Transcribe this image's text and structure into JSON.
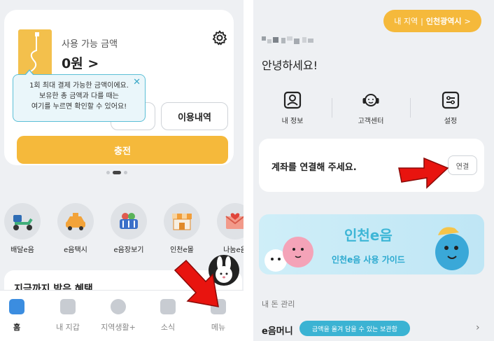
{
  "left": {
    "card": {
      "available_label": "사용 가능 금액",
      "available_amount": "0원 >",
      "history_button": "이용내역",
      "charge_button": "충전",
      "tooltip_lines": [
        "1회 최대 결제 가능한 금액이에요.",
        "보유한 총 금액과 다를 때는",
        "여기를 누르면 확인할 수 있어요!"
      ],
      "tooltip_close": "✕"
    },
    "services": [
      {
        "label": "배달e음",
        "icon": "scooter-icon"
      },
      {
        "label": "e음택시",
        "icon": "taxi-icon"
      },
      {
        "label": "e음장보기",
        "icon": "basket-icon"
      },
      {
        "label": "인천e몰",
        "icon": "store-icon"
      },
      {
        "label": "나눔e음",
        "icon": "heart-letter-icon"
      }
    ],
    "benefit_title": "지금까지 받은 혜택",
    "nav": [
      {
        "label": "홈",
        "icon": "home-icon",
        "active": true
      },
      {
        "label": "내 지갑",
        "icon": "wallet-icon",
        "active": false
      },
      {
        "label": "지역생활+",
        "icon": "local-life-icon",
        "active": false
      },
      {
        "label": "소식",
        "icon": "news-icon",
        "active": false
      },
      {
        "label": "메뉴",
        "icon": "menu-grid-icon",
        "active": false
      }
    ],
    "accent": "#f5b93b"
  },
  "right": {
    "region_label": "내 지역",
    "region_sep": "|",
    "region_value": "인천광역시",
    "region_chevron": ">",
    "greeting": "안녕하세요!",
    "quick": [
      {
        "label": "내 정보",
        "icon": "profile-icon"
      },
      {
        "label": "고객센터",
        "icon": "headset-icon"
      },
      {
        "label": "설정",
        "icon": "sliders-icon"
      }
    ],
    "connect_text": "계좌를 연결해 주세요.",
    "connect_button": "연결",
    "banner_title": "인천e음",
    "banner_sub": "인천e음 사용 가이드",
    "money_section": "내 돈 관리",
    "emoney_label": "e음머니",
    "emoney_tag": "금액을 올겨 담을 수 있는 보관함",
    "emoney_chevron": "›"
  }
}
